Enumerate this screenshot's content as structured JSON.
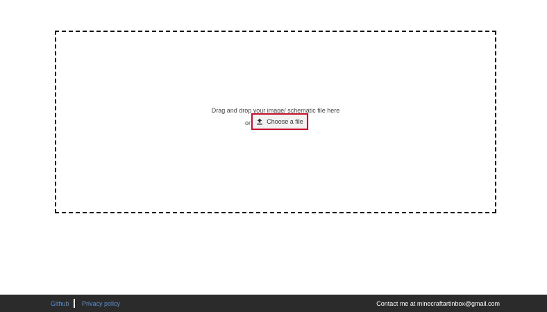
{
  "dropzone": {
    "instruction": "Drag and drop your image/ schematic file here",
    "or_label": "or",
    "choose_button_label": "Choose a file",
    "choose_button_icon": "upload-icon"
  },
  "footer": {
    "github_link": "Github",
    "privacy_link": "Privacy policy",
    "contact_text": "Contact me at minecraftartinbox@gmail.com"
  }
}
